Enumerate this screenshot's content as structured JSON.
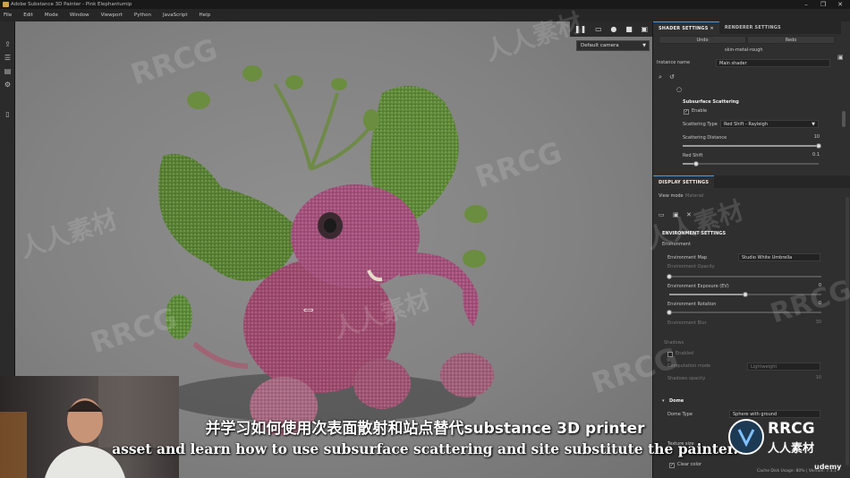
{
  "window": {
    "title": "Adobe Substance 3D Painter - Pink Elephantumip",
    "controls": [
      "–",
      "❐",
      "✕"
    ]
  },
  "menu": [
    "File",
    "Edit",
    "Mode",
    "Window",
    "Viewport",
    "Python",
    "JavaScript",
    "Help"
  ],
  "viewport": {
    "camera": "Default camera",
    "toolbar_icons": [
      "pause-icon",
      "frame-icon",
      "sphere-icon",
      "video-camera-icon",
      "screenshot-icon"
    ]
  },
  "shader_panel": {
    "tab_shader": "SHADER SETTINGS",
    "tab_renderer": "RENDERER SETTINGS",
    "btn_left": "Undo",
    "btn_right": "Redo",
    "shader_preset": "skin-metal-rough",
    "instance_label": "Instance name",
    "instance_value": "Main shader",
    "sss_header": "Subsurface Scattering",
    "enable_label": "Enable",
    "type_label": "Scattering Type",
    "type_value": "Red Shift - Rayleigh",
    "distance_label": "Scattering Distance",
    "distance_value": "10",
    "distance_fraction": 1.0,
    "redshift_label": "Red Shift",
    "redshift_value": "0.1",
    "redshift_fraction": 0.1
  },
  "display_panel": {
    "header": "DISPLAY SETTINGS",
    "view_mode_label": "View mode",
    "view_mode_value": "Material",
    "env_header": "ENVIRONMENT SETTINGS",
    "env_label": "Environment",
    "env_map_label": "Environment Map",
    "env_map_value": "Studio White Umbrella",
    "env_opacity_label": "Environment Opacity",
    "env_opacity_fraction": 0.0,
    "env_exposure_label": "Environment Exposure (EV)",
    "env_exposure_value": "0",
    "env_exposure_fraction": 0.5,
    "env_rotation_label": "Environment Rotation",
    "env_rotation_value": "0",
    "env_rotation_fraction": 0.0,
    "env_blur_label": "Environment Blur",
    "env_blur_value": "30",
    "shadows_label": "Shadows",
    "shadows_enable": "Enabled",
    "computation_label": "Computation mode",
    "computation_value": "Lightweight",
    "shadow_opacity_label": "Shadows opacity",
    "shadow_opacity_value": "10",
    "dome_label": "Dome",
    "dome_type_label": "Dome Type",
    "dome_type_value": "Sphere with ground",
    "texture_label": "Texture size",
    "clear_color_label": "Clear color"
  },
  "status": {
    "cache": "Cache Disk Usage:",
    "version": "80% | Version: 7.4.1"
  },
  "overlay": {
    "subtitle_zh": "并学习如何使用次表面散射和站点替代substance 3D printer",
    "subtitle_en": "asset and learn how to use subsurface scattering and site substitute the painter.",
    "watermark": "RRCG",
    "watermark_zh": "人人素材",
    "logo_text": "RRCG",
    "logo_sub": "人人素材",
    "udemy": "udemy"
  }
}
